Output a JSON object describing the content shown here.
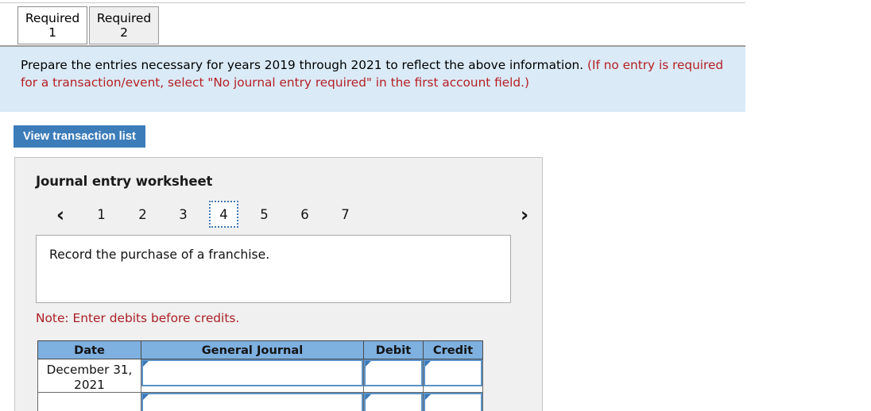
{
  "tabs": [
    {
      "line1": "Required",
      "line2": "1",
      "active": true
    },
    {
      "line1": "Required",
      "line2": "2",
      "active": false
    }
  ],
  "banner": {
    "text_black": "Prepare the entries necessary for years 2019 through 2021 to reflect the above information.",
    "text_red": "(If no entry is required for a transaction/event, select \"No journal entry required\" in the first account field.)"
  },
  "toolbar": {
    "view_transaction_list_label": "View transaction list"
  },
  "worksheet": {
    "title": "Journal entry worksheet",
    "pager": {
      "prev_icon": "chevron-left-icon",
      "next_icon": "chevron-right-icon",
      "pages": [
        "1",
        "2",
        "3",
        "4",
        "5",
        "6",
        "7"
      ],
      "selected": "4"
    },
    "description": "Record the purchase of a franchise.",
    "note": "Note: Enter debits before credits.",
    "table": {
      "headers": [
        "Date",
        "General Journal",
        "Debit",
        "Credit"
      ],
      "rows": [
        {
          "date_line1": "December 31,",
          "date_line2": "2021",
          "general_journal": "",
          "debit": "",
          "credit": ""
        },
        {
          "date_line1": "",
          "date_line2": "",
          "general_journal": "",
          "debit": "",
          "credit": ""
        }
      ]
    }
  },
  "colors": {
    "banner_bg": "#daeaf7",
    "banner_red": "#b61f24",
    "button_blue": "#3c7cb9",
    "table_header_blue": "#7eb0e0",
    "input_border_blue": "#5a92c8",
    "note_red": "#ab1f24",
    "panel_bg": "#f0f0f0",
    "focus_outline": "#3f78b5"
  }
}
